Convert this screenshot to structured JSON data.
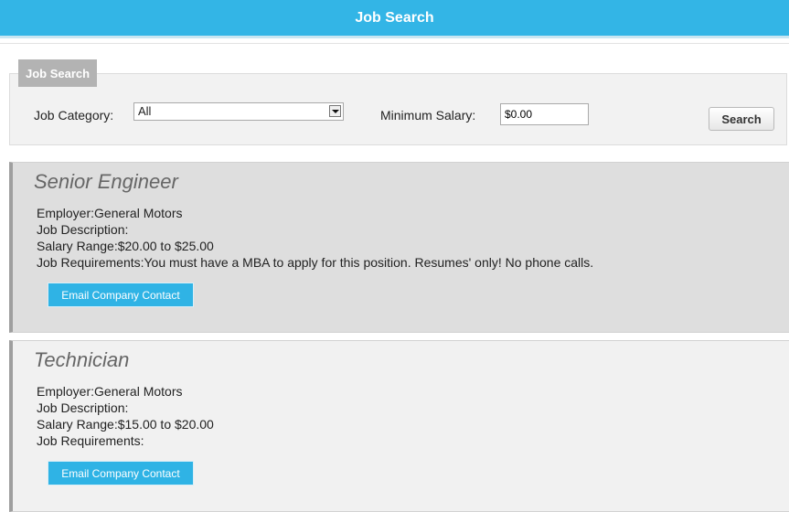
{
  "header": {
    "title": "Job Search"
  },
  "search": {
    "tab_label": "Job Search",
    "category_label": "Job Category:",
    "category_value": "All",
    "salary_label": "Minimum Salary:",
    "salary_value": "$0.00",
    "search_button": "Search"
  },
  "jobs": [
    {
      "title": "Senior Engineer",
      "employer": "Employer:General Motors",
      "description": "Job Description:",
      "salary_range": "Salary Range:$20.00 to $25.00",
      "requirements": "Job Requirements:You must have a MBA to apply for this position. Resumes' only! No phone calls.",
      "contact_button": "Email Company Contact"
    },
    {
      "title": "Technician",
      "employer": "Employer:General Motors",
      "description": "Job Description:",
      "salary_range": "Salary Range:$15.00 to $20.00",
      "requirements": "Job Requirements:",
      "contact_button": "Email Company Contact"
    }
  ],
  "colors": {
    "header_bg": "#33b5e6",
    "button_bg": "#2fb3e5",
    "card_selected_bg": "#dedede",
    "card_bg": "#f1f1f1"
  }
}
